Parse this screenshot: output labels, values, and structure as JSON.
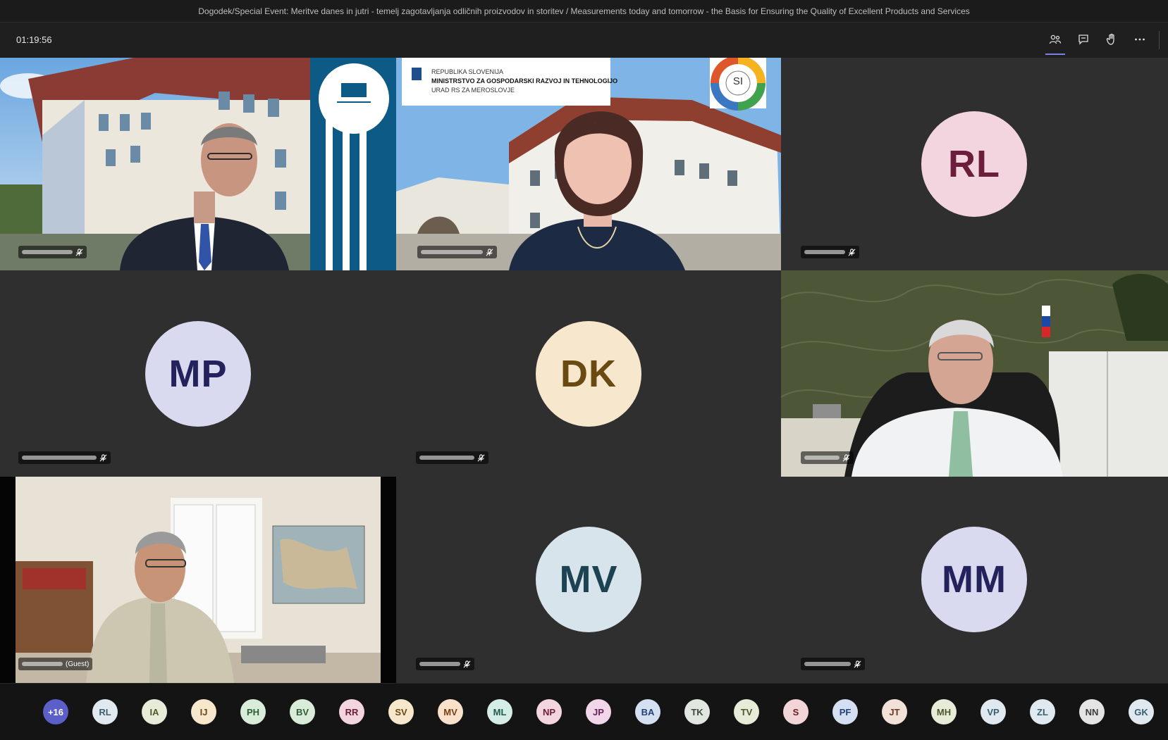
{
  "window": {
    "title": "Dogodek/Special Event: Meritve danes in jutri - temelj zagotavljanja odličnih proizvodov in storitev / Measurements today and tomorrow - the Basis for Ensuring the Quality of Excellent Products and Services"
  },
  "toolbar": {
    "timer": "01:19:56",
    "icons": [
      "people-icon",
      "chat-icon",
      "raise-hand-icon",
      "more-options-icon"
    ]
  },
  "tiles": [
    {
      "id": "tile-1",
      "kind": "video",
      "icon": "muted-mic-icon"
    },
    {
      "id": "tile-2",
      "kind": "video",
      "icon": "muted-mic-icon",
      "slide": {
        "line1": "REPUBLIKA SLOVENIJA",
        "line2": "MINISTRSTVO ZA GOSPODARSKI RAZVOJ IN TEHNOLOGIJO",
        "line3": "URAD RS ZA MEROSLOVJE",
        "badge": "SI"
      }
    },
    {
      "id": "tile-3",
      "kind": "avatar",
      "initials": "RL",
      "bg": "#f2d5df",
      "fg": "#6b1d3b"
    },
    {
      "id": "tile-4",
      "kind": "avatar",
      "initials": "MP",
      "bg": "#d9d9ef",
      "fg": "#24225c"
    },
    {
      "id": "tile-5",
      "kind": "avatar",
      "initials": "DK",
      "bg": "#f6e7cd",
      "fg": "#6b4a12"
    },
    {
      "id": "tile-6",
      "kind": "video",
      "icon": "muted-mic-icon"
    },
    {
      "id": "tile-7",
      "kind": "video",
      "guest_label": "(Guest)"
    },
    {
      "id": "tile-8",
      "kind": "avatar",
      "initials": "MV",
      "bg": "#d8e4ec",
      "fg": "#1d4252"
    },
    {
      "id": "tile-9",
      "kind": "avatar",
      "initials": "MM",
      "bg": "#d9d9ef",
      "fg": "#24225c"
    }
  ],
  "participants": {
    "overflow": "+16",
    "chips": [
      {
        "initials": "RL",
        "bg": "#dfe9ef",
        "fg": "#3a5f72"
      },
      {
        "initials": "IA",
        "bg": "#e7ecd9",
        "fg": "#4b5a2a"
      },
      {
        "initials": "IJ",
        "bg": "#f6e7cd",
        "fg": "#6b4a12"
      },
      {
        "initials": "PH",
        "bg": "#d8ecd9",
        "fg": "#2e5d34"
      },
      {
        "initials": "BV",
        "bg": "#d8ecd9",
        "fg": "#2e5d34"
      },
      {
        "initials": "RR",
        "bg": "#f2d5df",
        "fg": "#6b1d3b"
      },
      {
        "initials": "SV",
        "bg": "#f6e7cd",
        "fg": "#6b4a12"
      },
      {
        "initials": "MV",
        "bg": "#f9e1cc",
        "fg": "#7a3f10"
      },
      {
        "initials": "ML",
        "bg": "#d6ece6",
        "fg": "#1f5a4a"
      },
      {
        "initials": "NP",
        "bg": "#f2d5df",
        "fg": "#6b1d3b"
      },
      {
        "initials": "JP",
        "bg": "#f0d6e8",
        "fg": "#6a2458"
      },
      {
        "initials": "BA",
        "bg": "#d5dff2",
        "fg": "#24407a"
      },
      {
        "initials": "TK",
        "bg": "#e1e6e1",
        "fg": "#3d4a3d"
      },
      {
        "initials": "TV",
        "bg": "#e7ecd9",
        "fg": "#4b5a2a"
      },
      {
        "initials": "S",
        "bg": "#f2d5d7",
        "fg": "#6b1d24"
      },
      {
        "initials": "PF",
        "bg": "#d5dff2",
        "fg": "#24407a"
      },
      {
        "initials": "JT",
        "bg": "#f2e1d9",
        "fg": "#6b3a25"
      },
      {
        "initials": "MH",
        "bg": "#e7ecd9",
        "fg": "#4b5a2a"
      },
      {
        "initials": "VP",
        "bg": "#dfe9ef",
        "fg": "#3a5f72"
      },
      {
        "initials": "ZL",
        "bg": "#dfe9ef",
        "fg": "#3a5f72"
      },
      {
        "initials": "NN",
        "bg": "#e4e4e4",
        "fg": "#3d3d3d"
      },
      {
        "initials": "GK",
        "bg": "#dfe9ef",
        "fg": "#3a5f72"
      }
    ]
  },
  "colors": {
    "overflow_chip_bg": "#5b5fc7",
    "accent": "#7b83eb"
  }
}
